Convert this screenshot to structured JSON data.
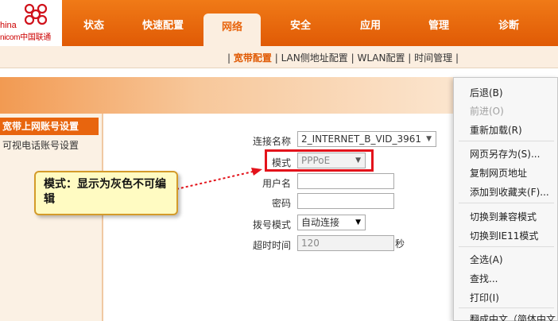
{
  "logo": {
    "line1": "hina",
    "line2": "nicom中国联通"
  },
  "nav": {
    "tabs": [
      {
        "label": "状态"
      },
      {
        "label": "快速配置"
      },
      {
        "label": "网络"
      },
      {
        "label": "安全"
      },
      {
        "label": "应用"
      },
      {
        "label": "管理"
      },
      {
        "label": "诊断"
      }
    ],
    "active": "网络"
  },
  "subnav": {
    "items": [
      "宽带配置",
      "LAN侧地址配置",
      "WLAN配置",
      "时间管理"
    ],
    "separator": "|"
  },
  "leftmenu": {
    "items": [
      "宽带上网账号设置",
      "可视电话账号设置"
    ]
  },
  "form": {
    "connection_name": {
      "label": "连接名称",
      "value": "2_INTERNET_B_VID_3961"
    },
    "mode": {
      "label": "模式",
      "value": "PPPoE"
    },
    "username": {
      "label": "用户名",
      "value": ""
    },
    "password": {
      "label": "密码",
      "value": ""
    },
    "dial_mode": {
      "label": "拨号模式",
      "value": "自动连接"
    },
    "timeout": {
      "label": "超时时间",
      "value": "120",
      "unit": "秒"
    }
  },
  "callout": {
    "text": "模式：显示为灰色不可编辑"
  },
  "context_menu": {
    "items": [
      {
        "label": "后退(B)",
        "enabled": true
      },
      {
        "label": "前进(O)",
        "enabled": false
      },
      {
        "label": "重新加载(R)",
        "enabled": true
      },
      {
        "label": "网页另存为(S)...",
        "enabled": true
      },
      {
        "label": "复制网页地址",
        "enabled": true
      },
      {
        "label": "添加到收藏夹(F)...",
        "enabled": true
      },
      {
        "label": "切换到兼容模式",
        "enabled": true
      },
      {
        "label": "切换到IE11模式",
        "enabled": true
      },
      {
        "label": "全选(A)",
        "enabled": true
      },
      {
        "label": "查找...",
        "enabled": true
      },
      {
        "label": "打印(I)",
        "enabled": true
      },
      {
        "label": "翻成中文（简体中文",
        "enabled": true
      }
    ]
  },
  "colors": {
    "brand": "#e8650e",
    "highlight": "#e3131b",
    "callout_bg": "#fffbc2"
  }
}
